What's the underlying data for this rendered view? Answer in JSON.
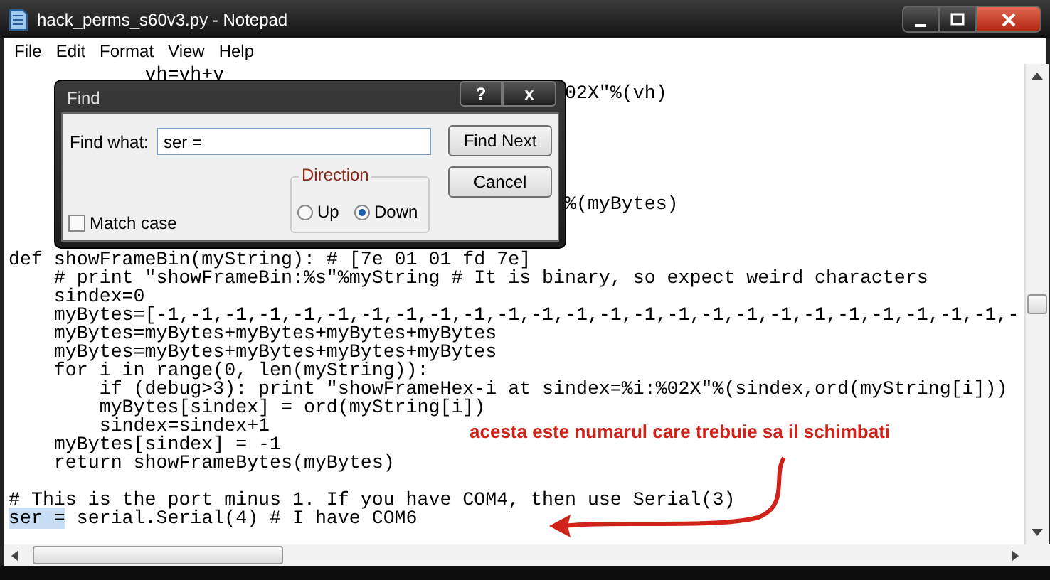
{
  "window": {
    "title": "hack_perms_s60v3.py - Notepad"
  },
  "menu": [
    {
      "label": "File"
    },
    {
      "label": "Edit"
    },
    {
      "label": "Format"
    },
    {
      "label": "View"
    },
    {
      "label": "Help"
    }
  ],
  "editor": {
    "lines": [
      {
        "kind": "code",
        "text": "            vh=vh+v"
      },
      {
        "kind": "partial",
        "text": "02X\"%(vh)"
      },
      {
        "kind": "blank"
      },
      {
        "kind": "blank"
      },
      {
        "kind": "blank"
      },
      {
        "kind": "blank"
      },
      {
        "kind": "blank"
      },
      {
        "kind": "partial",
        "text": "%(myBytes)"
      },
      {
        "kind": "blank"
      },
      {
        "kind": "blank"
      },
      {
        "kind": "code",
        "text": "def showFrameBin(myString): # [7e 01 01 fd 7e]"
      },
      {
        "kind": "code",
        "text": "    # print \"showFrameBin:%s\"%myString # It is binary, so expect weird characters"
      },
      {
        "kind": "code",
        "text": "    sindex=0"
      },
      {
        "kind": "code",
        "text": "    myBytes=[-1,-1,-1,-1,-1,-1,-1,-1,-1,-1,-1,-1,-1,-1,-1,-1,-1,-1,-1,-1,-1,-1,-1,-1,-1,-"
      },
      {
        "kind": "code",
        "text": "    myBytes=myBytes+myBytes+myBytes+myBytes"
      },
      {
        "kind": "code",
        "text": "    myBytes=myBytes+myBytes+myBytes+myBytes"
      },
      {
        "kind": "code",
        "text": "    for i in range(0, len(myString)):"
      },
      {
        "kind": "code",
        "text": "        if (debug>3): print \"showFrameHex-i at sindex=%i:%02X\"%(sindex,ord(myString[i]))"
      },
      {
        "kind": "code",
        "text": "        myBytes[sindex] = ord(myString[i])"
      },
      {
        "kind": "code",
        "text": "        sindex=sindex+1"
      },
      {
        "kind": "code",
        "text": "    myBytes[sindex] = -1"
      },
      {
        "kind": "code",
        "text": "    return showFrameBytes(myBytes)"
      },
      {
        "kind": "blank"
      },
      {
        "kind": "code",
        "text": "# This is the port minus 1. If you have COM4, then use Serial(3)"
      },
      {
        "kind": "selection",
        "selected_text": "ser =",
        "text": " serial.Serial(4) # I have COM6"
      }
    ]
  },
  "find_dialog": {
    "title": "Find",
    "help_button": "?",
    "close_button": "x",
    "find_what_label": "Find what:",
    "find_what_value": "ser =",
    "find_next_button": "Find Next",
    "cancel_button": "Cancel",
    "match_case": {
      "label": "Match case",
      "checked": false
    },
    "direction": {
      "label": "Direction",
      "options": [
        {
          "label": "Up",
          "selected": false
        },
        {
          "label": "Down",
          "selected": true
        }
      ]
    }
  },
  "annotation": {
    "text": "acesta este numarul care trebuie sa il schimbati"
  }
}
